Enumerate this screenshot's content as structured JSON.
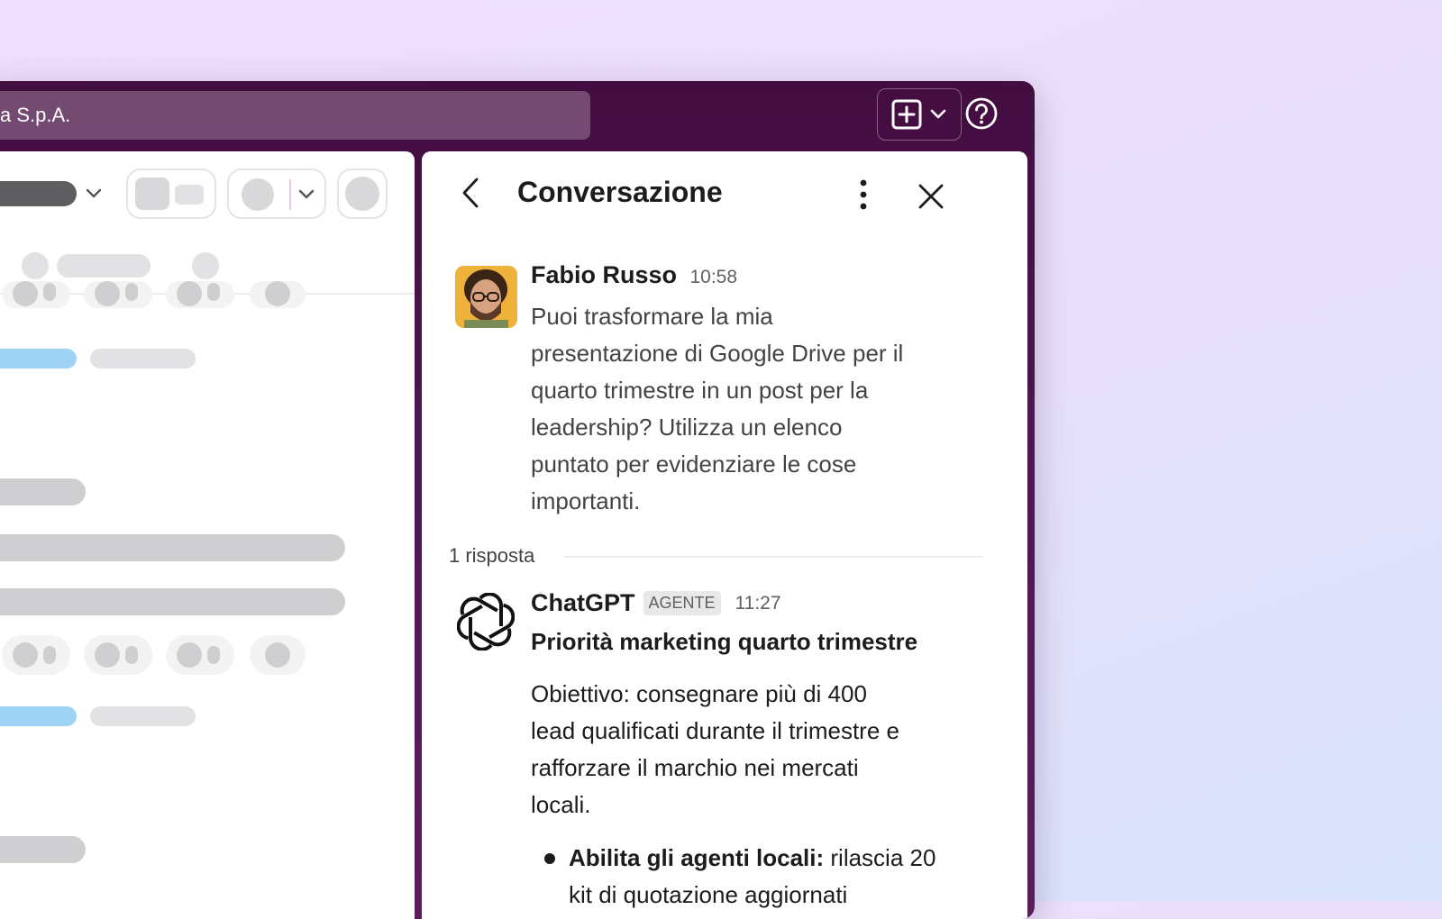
{
  "workspace": {
    "search_text": "a S.p.A."
  },
  "thread": {
    "title": "Conversazione",
    "original": {
      "author": "Fabio Russo",
      "time": "10:58",
      "lines": [
        "Puoi trasformare la mia",
        "presentazione di Google Drive per il",
        "quarto trimestre in un post per la",
        "leadership? Utilizza un elenco",
        "puntato per evidenziare le cose",
        "importanti."
      ]
    },
    "replies_label": "1 risposta",
    "reply": {
      "author": "ChatGPT",
      "badge": "AGENTE",
      "time": "11:27",
      "heading": "Priorità marketing quarto trimestre",
      "body_lines": [
        "Obiettivo: consegnare più di 400",
        "lead qualificati durante il trimestre e",
        "rafforzare il marchio nei mercati",
        "locali."
      ],
      "bullet": {
        "bold": "Abilita gli agenti locali:",
        "text": " rilascia 20",
        "line2": "kit di quotazione aggiornati"
      }
    }
  },
  "colors": {
    "window": "#43103f",
    "accent_blue": "#9fd3f5"
  },
  "icons": [
    "compose-icon",
    "chevron-down-icon",
    "help-icon",
    "back-icon",
    "more-vertical-icon",
    "close-icon",
    "openai-logo-icon"
  ]
}
